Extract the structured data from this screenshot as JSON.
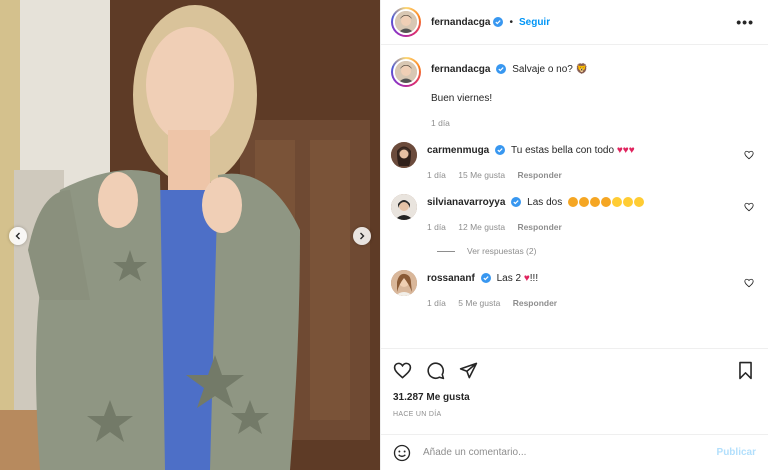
{
  "post": {
    "author": {
      "username": "fernandacga",
      "verified": true,
      "follow_label": "Seguir",
      "separator": "•",
      "more_label": "•••"
    },
    "caption": {
      "text": "Salvaje o no? 🦁",
      "extra": "Buen viernes!",
      "time": "1 día"
    },
    "comments": [
      {
        "username": "carmenmuga",
        "verified": true,
        "text": "Tu estas bella con todo",
        "emojis": [
          "#e0245e",
          "#e0245e",
          "#e0245e"
        ],
        "time": "1 día",
        "likes": "15 Me gusta",
        "reply_label": "Responder"
      },
      {
        "username": "silvianavarroyya",
        "verified": true,
        "text": "Las dos",
        "emojis": [
          "#f5a623",
          "#f5a623",
          "#f5a623",
          "#f5a623",
          "#ffcc33",
          "#ffcc33",
          "#ffcc33"
        ],
        "time": "1 día",
        "likes": "12 Me gusta",
        "reply_label": "Responder",
        "view_replies": "Ver respuestas (2)"
      },
      {
        "username": "rossananf",
        "verified": true,
        "text": "Las 2",
        "emojis": [
          "#e0245e"
        ],
        "text_after": "!!!",
        "time": "1 día",
        "likes": "5 Me gusta",
        "reply_label": "Responder"
      }
    ],
    "likes": "31.287 Me gusta",
    "posted": "HACE UN DÍA",
    "comment_input": {
      "placeholder": "Añade un comentario...",
      "publish_label": "Publicar"
    },
    "icons": {
      "like": "heart-icon",
      "comment": "comment-icon",
      "share": "share-icon",
      "save": "bookmark-icon",
      "emoji": "emoji-icon",
      "prev": "chevron-left-icon",
      "next": "chevron-right-icon",
      "verified": "verified-badge-icon"
    },
    "colors": {
      "accent": "#0095f6",
      "verified": "#3897f0",
      "muted": "#8e8e8e",
      "publish_disabled": "#b2dffc"
    }
  }
}
